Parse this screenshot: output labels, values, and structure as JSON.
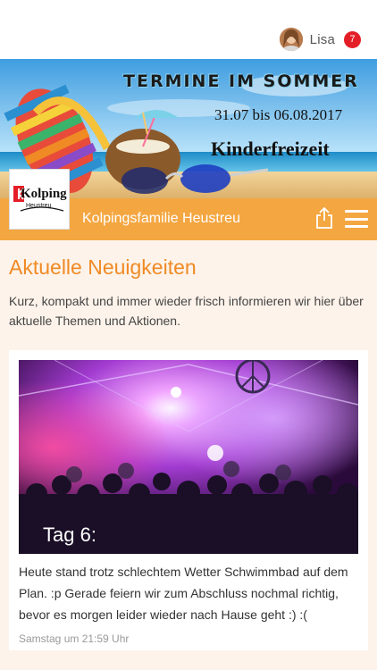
{
  "header": {
    "user_name": "Lisa",
    "notification_count": "7",
    "avatar": "avatar-photo",
    "badge_color": "#e41e26"
  },
  "banner": {
    "title": "TERMINE IM SOMMER",
    "dates": "31.07 bis 06.08.2017",
    "subtitle": "Kinderfreizeit"
  },
  "club": {
    "name": "Kolpingsfamilie Heustreu",
    "logo_text": "Kolping",
    "logo_sub": "Heustreu",
    "bar_color": "#f4a640",
    "share_icon": "share-icon",
    "menu_icon": "hamburger-menu-icon"
  },
  "main": {
    "section_title": "Aktuelle Neuigkeiten",
    "intro": "Kurz, kompakt und immer wieder frisch informieren wir hier über aktuelle Themen und Aktionen.",
    "accent_color": "#f08a24",
    "news": [
      {
        "image_caption": "Tag 6:",
        "text": "Heute stand trotz schlechtem Wetter Schwimmbad auf dem Plan. :p Gerade feiern wir zum Abschluss nochmal richtig, bevor es morgen leider wieder nach Hause geht :) :(",
        "time": "Samstag um 21:59 Uhr"
      }
    ]
  }
}
